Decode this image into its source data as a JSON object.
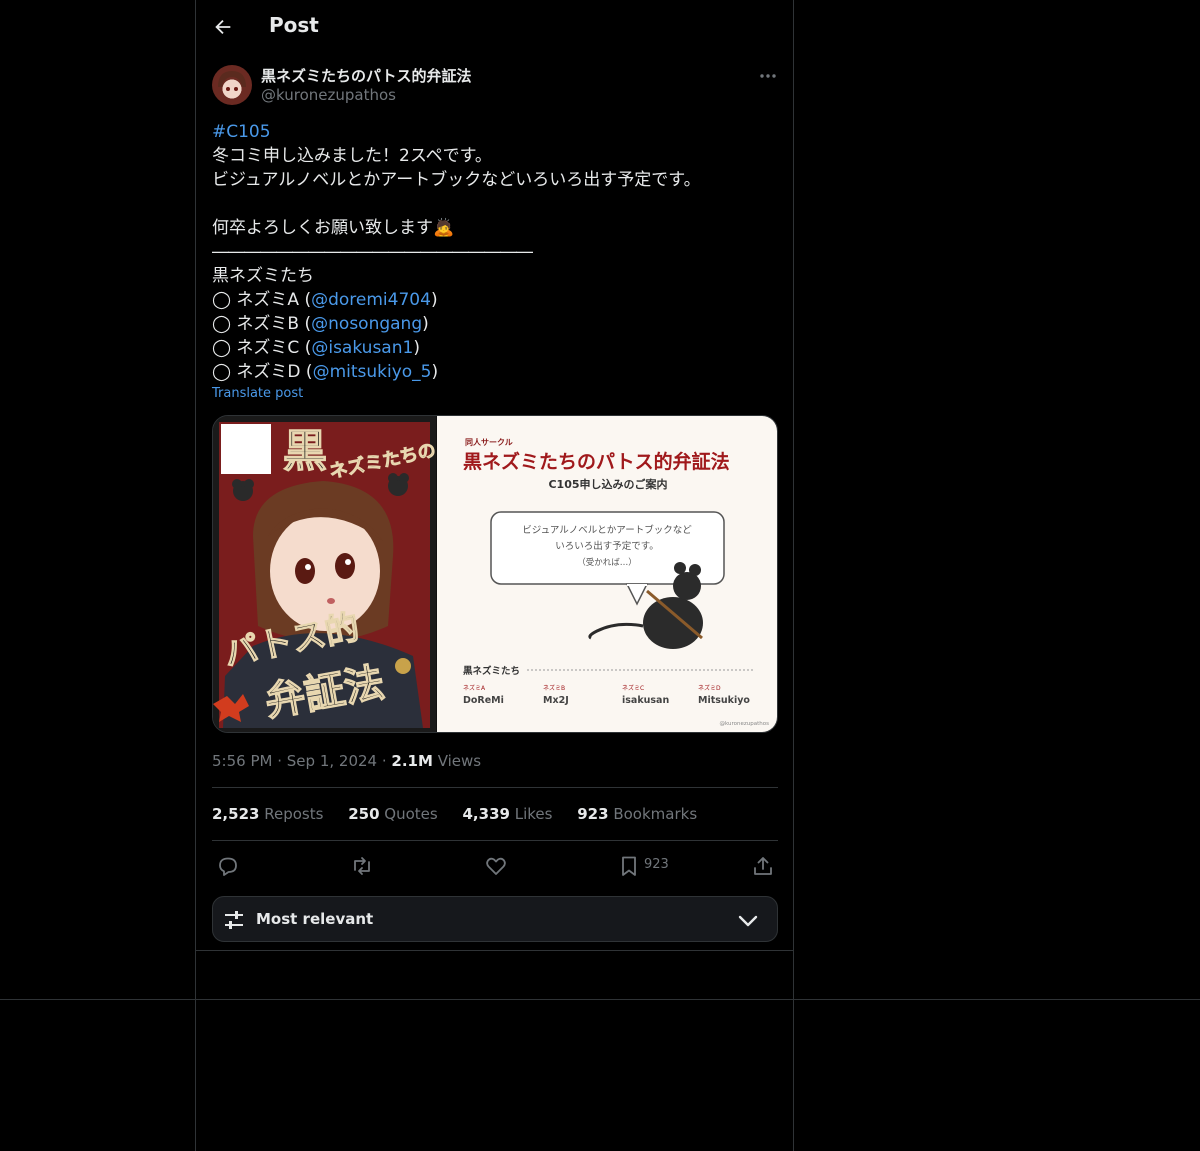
{
  "header": {
    "title": "Post"
  },
  "author": {
    "name": "黒ネズミたちのパトス的弁証法",
    "handle": "@kuronezupathos"
  },
  "tweet": {
    "hashtag": "#C105",
    "line1": "冬コミ申し込みました！2スペです。",
    "line2": "ビジュアルノベルとかアートブックなどいろいろ出す予定です。",
    "line3": "何卒よろしくお願い致します🙇",
    "separator": "――――――――――――――――――――",
    "group": "黒ネズミたち",
    "members": [
      {
        "prefix": "◯ ネズミA (",
        "handle": "@doremi4704",
        "suffix": ")"
      },
      {
        "prefix": "◯ ネズミB (",
        "handle": "@nosongang",
        "suffix": ")"
      },
      {
        "prefix": "◯ ネズミC (",
        "handle": "@isakusan1",
        "suffix": ")"
      },
      {
        "prefix": "◯ ネズミD (",
        "handle": "@mitsukiyo_5",
        "suffix": ")"
      }
    ],
    "translate": "Translate post"
  },
  "media": {
    "cover": {
      "title_a": "黒",
      "title_b": "ネズミたちの",
      "title_c": "パトス的",
      "title_d": "弁証法"
    },
    "flyer": {
      "circle_label": "同人サークル",
      "title": "黒ネズミたちのパトス的弁証法",
      "subtitle": "C105申し込みのご案内",
      "bubble_line1": "ビジュアルノベルとかアートブックなど",
      "bubble_line2": "いろいろ出す予定です。",
      "bubble_line3": "（受かれば…）",
      "members_title": "黒ネズミたち",
      "members": [
        {
          "role": "ネズミA",
          "name": "DoReMi"
        },
        {
          "role": "ネズミB",
          "name": "Mx2J"
        },
        {
          "role": "ネズミC",
          "name": "isakusan"
        },
        {
          "role": "ネズミD",
          "name": "Mitsukiyo"
        }
      ],
      "credit": "@kuronezupathos"
    }
  },
  "meta": {
    "time": "5:56 PM",
    "date": "Sep 1, 2024",
    "views_count": "2.1M",
    "views_label": "Views"
  },
  "stats": {
    "reposts_count": "2,523",
    "reposts_label": "Reposts",
    "quotes_count": "250",
    "quotes_label": "Quotes",
    "likes_count": "4,339",
    "likes_label": "Likes",
    "bookmarks_count": "923",
    "bookmarks_label": "Bookmarks"
  },
  "actions": {
    "bookmark_count": "923"
  },
  "sort": {
    "label": "Most relevant"
  },
  "icons": [
    "back-arrow-icon",
    "more-icon",
    "reply-icon",
    "repost-icon",
    "like-icon",
    "bookmark-icon",
    "share-icon",
    "sliders-icon",
    "chevron-down-icon"
  ]
}
